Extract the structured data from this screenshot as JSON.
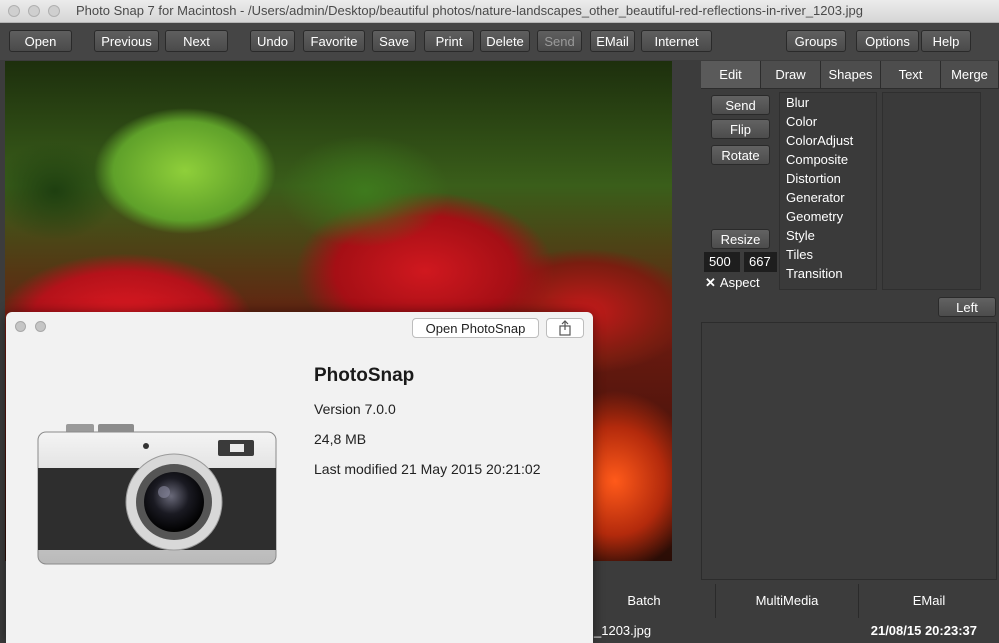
{
  "window": {
    "title": "Photo Snap 7 for Macintosh - /Users/admin/Desktop/beautiful photos/nature-landscapes_other_beautiful-red-reflections-in-river_1203.jpg"
  },
  "toolbar": {
    "open": "Open",
    "previous": "Previous",
    "next": "Next",
    "undo": "Undo",
    "favorite": "Favorite",
    "save": "Save",
    "print": "Print",
    "delete": "Delete",
    "send": "Send",
    "email": "EMail",
    "internet": "Internet",
    "groups": "Groups",
    "options": "Options",
    "help": "Help"
  },
  "panel": {
    "tabs": [
      "Edit",
      "Draw",
      "Shapes",
      "Text",
      "Merge"
    ],
    "buttons": {
      "send": "Send",
      "flip": "Flip",
      "rotate": "Rotate",
      "resize": "Resize",
      "left": "Left"
    },
    "filters": [
      "Blur",
      "Color",
      "ColorAdjust",
      "Composite",
      "Distortion",
      "Generator",
      "Geometry",
      "Style",
      "Tiles",
      "Transition"
    ],
    "width_value": "500",
    "height_value": "667",
    "aspect_mark": "✕",
    "aspect_label": "Aspect"
  },
  "bottom": {
    "tabs": [
      "Batch",
      "MultiMedia",
      "EMail"
    ],
    "filename": "_1203.jpg",
    "timestamp": "21/08/15 20:23:37"
  },
  "about": {
    "open_button": "Open PhotoSnap",
    "app_name": "PhotoSnap",
    "version": "Version 7.0.0",
    "size": "24,8 MB",
    "modified": "Last modified 21 May 2015 20:21:02"
  },
  "colors": {
    "app_background": "#3c3c3c",
    "dialog_background": "#f2f2f2"
  }
}
